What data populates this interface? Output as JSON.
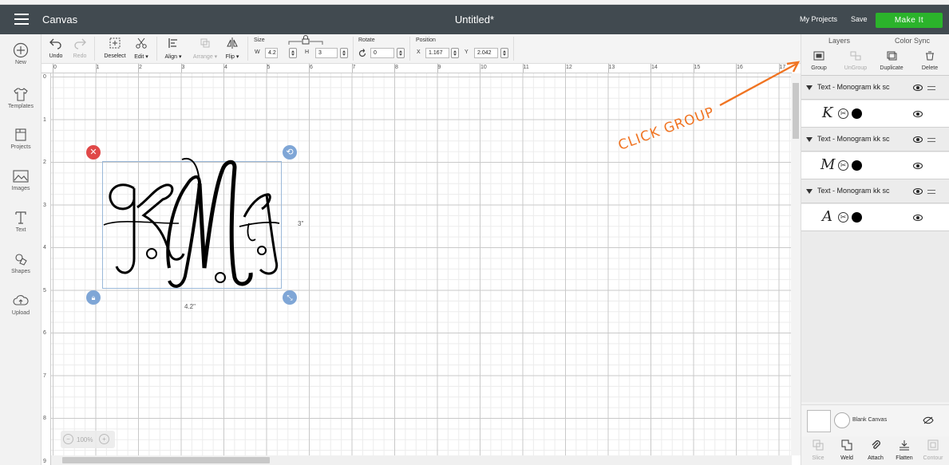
{
  "header": {
    "app_name": "Canvas",
    "doc_title": "Untitled*",
    "my_projects": "My Projects",
    "save": "Save",
    "make_it": "Make It",
    "make_it_color": "#2bb32b"
  },
  "sidebar": {
    "items": [
      {
        "label": "New",
        "icon": "plus-circle-icon"
      },
      {
        "label": "Templates",
        "icon": "shirt-icon"
      },
      {
        "label": "Projects",
        "icon": "projects-icon"
      },
      {
        "label": "Images",
        "icon": "image-icon"
      },
      {
        "label": "Text",
        "icon": "text-icon"
      },
      {
        "label": "Shapes",
        "icon": "shapes-icon"
      },
      {
        "label": "Upload",
        "icon": "upload-icon"
      }
    ]
  },
  "toolbar": {
    "undo": "Undo",
    "redo": "Redo",
    "deselect": "Deselect",
    "edit": "Edit ▾",
    "align": "Align ▾",
    "arrange": "Arrange ▾",
    "flip": "Flip ▾",
    "size_label": "Size",
    "w_label": "W",
    "w_value": "4.2",
    "h_label": "H",
    "h_value": "3",
    "rotate_label": "Rotate",
    "rotate_value": "0",
    "position_label": "Position",
    "x_label": "X",
    "x_value": "1.167",
    "y_label": "Y",
    "y_value": "2.042"
  },
  "rulers": {
    "h": [
      "0",
      "1",
      "2",
      "3",
      "4",
      "5",
      "6",
      "7",
      "8",
      "9",
      "10",
      "11",
      "12",
      "13",
      "14",
      "15",
      "16",
      "17"
    ],
    "v": [
      "0",
      "1",
      "2",
      "3",
      "4",
      "5",
      "6",
      "7",
      "8",
      "9"
    ]
  },
  "canvas": {
    "width_label": "4.2\"",
    "height_label": "3\"",
    "monogram_text": "KMA",
    "zoom": "100%",
    "annotation": "CLICK GROUP",
    "annotation_color": "#f07422"
  },
  "panel": {
    "tabs": [
      "Layers",
      "Color Sync"
    ],
    "tools": [
      {
        "label": "Group",
        "icon": "group-icon",
        "enabled": true
      },
      {
        "label": "UnGroup",
        "icon": "ungroup-icon",
        "enabled": false
      },
      {
        "label": "Duplicate",
        "icon": "duplicate-icon",
        "enabled": true
      },
      {
        "label": "Delete",
        "icon": "trash-icon",
        "enabled": true
      }
    ],
    "layers": [
      {
        "name": "Text - Monogram kk sc",
        "glyph": "K"
      },
      {
        "name": "Text - Monogram kk sc",
        "glyph": "M"
      },
      {
        "name": "Text - Monogram kk sc",
        "glyph": "A"
      }
    ],
    "blank_canvas": "Blank Canvas",
    "bottom_tools": [
      {
        "label": "Slice",
        "enabled": false
      },
      {
        "label": "Weld",
        "enabled": true
      },
      {
        "label": "Attach",
        "enabled": true
      },
      {
        "label": "Flatten",
        "enabled": true
      },
      {
        "label": "Contour",
        "enabled": false
      }
    ]
  }
}
